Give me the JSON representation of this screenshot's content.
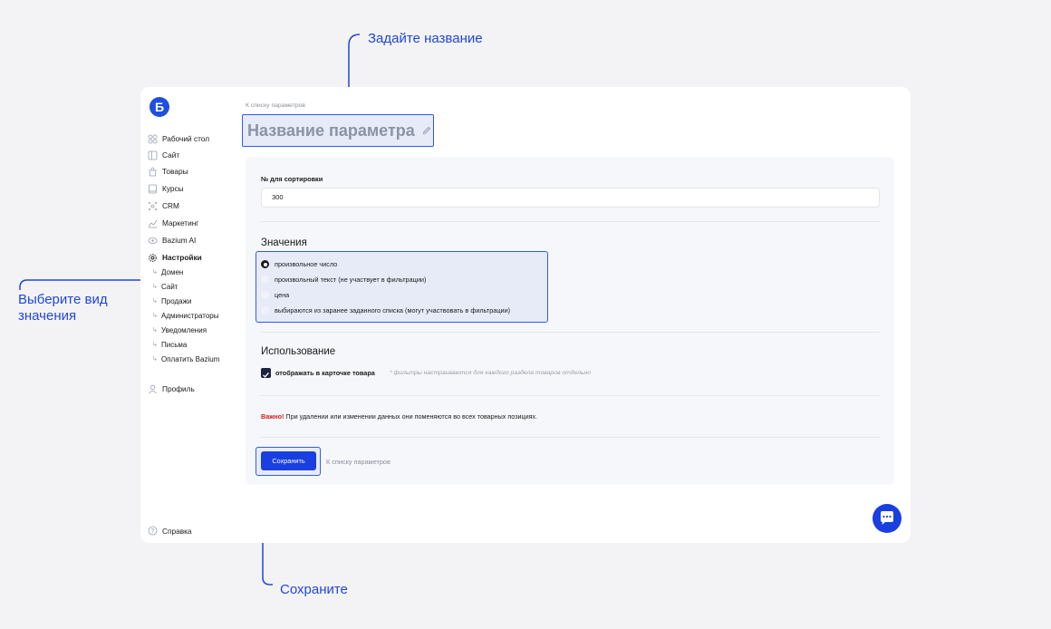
{
  "annotations": {
    "set_name": "Задайте название",
    "choose_type_line1": "Выберите вид",
    "choose_type_line2": "значения",
    "save": "Сохраните"
  },
  "logo_letter": "Б",
  "sidebar": {
    "items": [
      {
        "label": "Рабочий стол",
        "icon": "dashboard-icon"
      },
      {
        "label": "Сайт",
        "icon": "site-icon"
      },
      {
        "label": "Товары",
        "icon": "bag-icon"
      },
      {
        "label": "Курсы",
        "icon": "book-icon"
      },
      {
        "label": "CRM",
        "icon": "crm-icon"
      },
      {
        "label": "Маркетинг",
        "icon": "chart-icon"
      },
      {
        "label": "Bazium AI",
        "icon": "ai-icon"
      },
      {
        "label": "Настройки",
        "icon": "gear-icon"
      }
    ],
    "settings_subitems": [
      "Домен",
      "Сайт",
      "Продажи",
      "Администраторы",
      "Уведомления",
      "Письма",
      "Оплатить Bazium"
    ],
    "profile": "Профиль",
    "help": "Справка"
  },
  "breadcrumb": "К списку параметров",
  "title": "Название параметра",
  "sort": {
    "label": "№ для сортировки",
    "value": "300"
  },
  "values_section": {
    "title": "Значения",
    "options": [
      {
        "label": "произвольное число",
        "selected": true
      },
      {
        "label": "произвольный текст (не участвует в фильтрации)",
        "selected": false
      },
      {
        "label": "цена",
        "selected": false
      },
      {
        "label": "выбираются из заранее заданного списка (могут участвовать в фильтрации)",
        "selected": false
      }
    ]
  },
  "usage_section": {
    "title": "Использование",
    "checkbox_label": "отображать в карточке товара",
    "checkbox_checked": true,
    "hint": "* фильтры настраиваются для каждого раздела товаров отдельно"
  },
  "warning": {
    "prefix": "Важно!",
    "text": " При удалении или изменении данных они поменяются во всех товарных позициях."
  },
  "actions": {
    "save_label": "Сохранить",
    "back_label": "К списку параметров"
  },
  "colors": {
    "accent": "#1a3fe0",
    "annotation": "#2146d8",
    "highlight": "#e7ebf8",
    "warning": "#d81b1b"
  }
}
